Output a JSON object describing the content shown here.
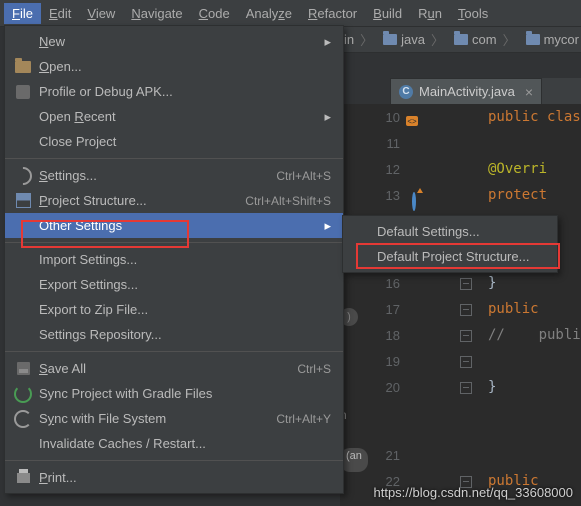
{
  "menubar": {
    "items": [
      {
        "u": "F",
        "rest": "ile",
        "sel": true
      },
      {
        "u": "E",
        "rest": "dit"
      },
      {
        "u": "V",
        "rest": "iew"
      },
      {
        "u": "N",
        "rest": "avigate"
      },
      {
        "u": "C",
        "rest": "ode"
      },
      {
        "u": "",
        "rest": "Analyze",
        "plain": true,
        "uAt": 5,
        "text": "Analyze"
      },
      {
        "u": "R",
        "rest": "efactor"
      },
      {
        "u": "B",
        "rest": "uild"
      },
      {
        "u": "",
        "rest": "Run",
        "uAt": 1,
        "text": "Run"
      },
      {
        "u": "T",
        "rest": "ools"
      }
    ]
  },
  "breadcrumb": {
    "items": [
      "in",
      "java",
      "com",
      "mycor"
    ]
  },
  "tab": {
    "name": "MainActivity.java",
    "icon": "C"
  },
  "file_menu": {
    "groups": [
      [
        {
          "label": "New",
          "arrow": true,
          "u": 0
        },
        {
          "label": "Open...",
          "icon": "open",
          "u": 0
        },
        {
          "label": "Profile or Debug APK...",
          "icon": "apk"
        },
        {
          "label": "Open Recent",
          "arrow": true,
          "uAt": "R",
          "text": "Open Recent"
        },
        {
          "label": "Close Project"
        }
      ],
      [
        {
          "label": "Settings...",
          "icon": "wrench",
          "sc": "Ctrl+Alt+S",
          "u": 0
        },
        {
          "label": "Project Structure...",
          "icon": "struct",
          "sc": "Ctrl+Alt+Shift+S",
          "u": 0
        },
        {
          "label": "Other Settings",
          "arrow": true,
          "hl": true
        }
      ],
      [
        {
          "label": "Import Settings..."
        },
        {
          "label": "Export Settings..."
        },
        {
          "label": "Export to Zip File..."
        },
        {
          "label": "Settings Repository..."
        }
      ],
      [
        {
          "label": "Save All",
          "icon": "disk",
          "sc": "Ctrl+S",
          "u": 0
        },
        {
          "label": "Sync Project with Gradle Files",
          "icon": "sync"
        },
        {
          "label": "Sync with File System",
          "icon": "sync2",
          "sc": "Ctrl+Alt+Y",
          "uAt": "y",
          "text": "Sync with File System"
        },
        {
          "label": "Invalidate Caches / Restart..."
        }
      ],
      [
        {
          "label": "Print...",
          "icon": "print",
          "u": 0
        }
      ]
    ]
  },
  "submenu": {
    "items": [
      {
        "label": "Default Settings..."
      },
      {
        "label": "Default Project Structure...",
        "boxed": true
      }
    ]
  },
  "code": {
    "lines": [
      {
        "n": 10,
        "html": "public clas",
        "cls": "kw",
        "mk": "tag"
      },
      {
        "n": 11,
        "html": ""
      },
      {
        "n": 12,
        "html": "@Overri",
        "cls": "ann"
      },
      {
        "n": 13,
        "html": "protect",
        "cls": "kw",
        "mk": "o"
      },
      {
        "n": 16,
        "html": "}",
        "cls": "br",
        "fold": true
      },
      {
        "n": 17,
        "html": "public",
        "cls": "kw",
        "fold": true
      },
      {
        "n": 18,
        "html": "//    publi",
        "cls": "cmt",
        "fold": true
      },
      {
        "n": 19,
        "html": "",
        "fold": true
      },
      {
        "n": 20,
        "html": "}",
        "cls": "br",
        "fold": true
      },
      {
        "n": 21,
        "html": ""
      },
      {
        "n": 22,
        "html": "public",
        "cls": "kw",
        "fold": true
      }
    ]
  },
  "pill": " (an",
  "pill2": ")",
  "nlab": "n",
  "watermark": "https://blog.csdn.net/qq_33608000"
}
